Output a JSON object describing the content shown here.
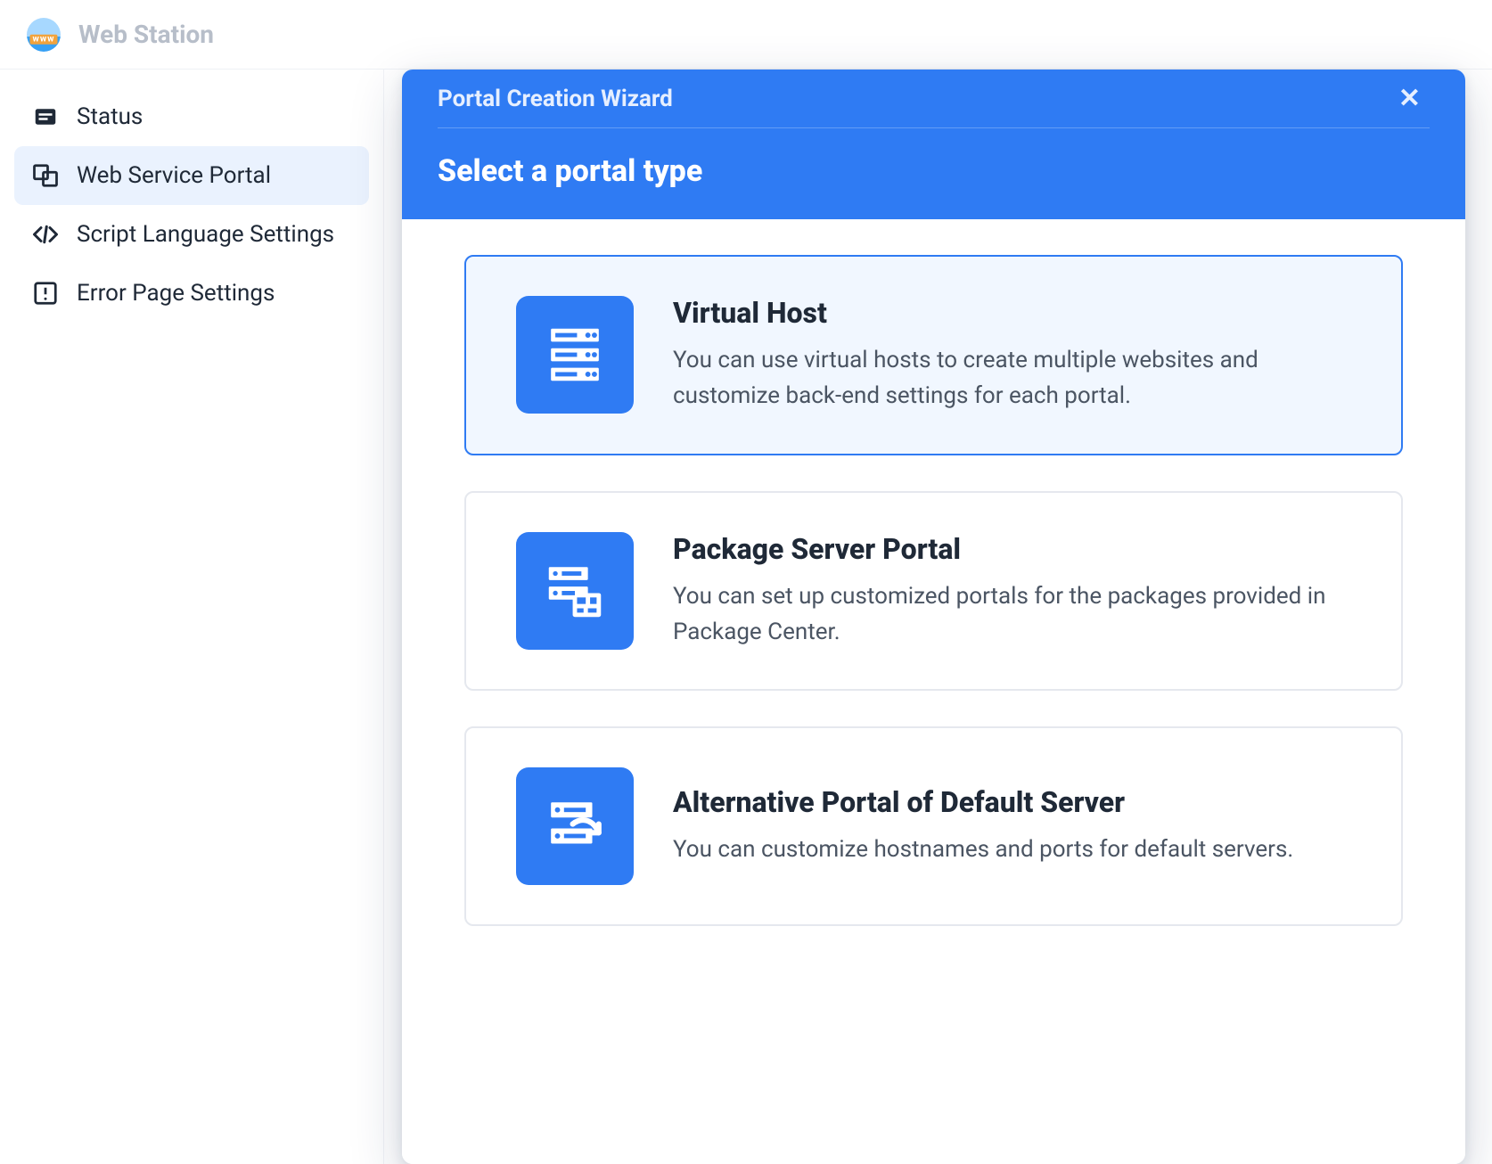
{
  "app": {
    "title": "Web Station"
  },
  "sidebar": {
    "items": [
      {
        "label": "Status",
        "icon": "status-icon",
        "active": false
      },
      {
        "label": "Web Service Portal",
        "icon": "portal-icon",
        "active": true
      },
      {
        "label": "Script Language Settings",
        "icon": "code-icon",
        "active": false
      },
      {
        "label": "Error Page Settings",
        "icon": "error-icon",
        "active": false
      }
    ]
  },
  "wizard": {
    "bar_title": "Portal Creation Wizard",
    "close_glyph": "✕",
    "subtitle": "Select a portal type",
    "options": [
      {
        "title": "Virtual Host",
        "description": "You can use virtual hosts to create multiple websites and customize back-end settings for each portal.",
        "icon": "server-stack-icon",
        "selected": true
      },
      {
        "title": "Package Server Portal",
        "description": "You can set up customized portals for the packages provided in Package Center.",
        "icon": "package-server-icon",
        "selected": false
      },
      {
        "title": "Alternative Portal of Default Server",
        "description": "You can customize hostnames and ports for default servers.",
        "icon": "alt-server-icon",
        "selected": false
      }
    ]
  }
}
